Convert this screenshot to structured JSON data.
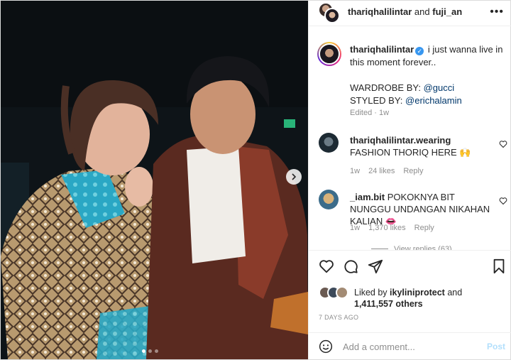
{
  "header": {
    "user1": "thariqhalilintar",
    "joiner": "and",
    "user2": "fuji_an",
    "more_icon": "more-horizontal-icon"
  },
  "caption": {
    "username": "thariqhalilintar",
    "text": "i just wanna live in this moment forever..",
    "wardrobe_label": "WARDROBE BY:",
    "wardrobe_tag": "@gucci",
    "styled_label": "STYLED BY:",
    "styled_tag": "@erichalamin",
    "edited": "Edited",
    "edited_time": "1w"
  },
  "comments": [
    {
      "username": "thariqhalilintar.wearing",
      "text": "FASHION THORIQ HERE 🙌",
      "time": "1w",
      "likes": "24 likes",
      "reply": "Reply"
    },
    {
      "username": "_iam.bit",
      "text": "POKOKNYA BIT NUNGGU UNDANGAN NIKAHAN KALIAN 👄",
      "time": "1w",
      "likes": "1,370 likes",
      "reply": "Reply"
    }
  ],
  "view_replies": "View replies (63)",
  "likes": {
    "prefix": "Liked by",
    "user": "ikyliniprotect",
    "and": "and",
    "count": "1,411,557 others"
  },
  "date": "7 DAYS AGO",
  "comment_box": {
    "placeholder": "Add a comment...",
    "post_label": "Post"
  },
  "carousel": {
    "slide_count": 3,
    "active_index": 0
  },
  "colors": {
    "link": "#00376b",
    "verified": "#3897f0",
    "post_button": "#b2dffc",
    "muted": "#8e8e8e"
  }
}
